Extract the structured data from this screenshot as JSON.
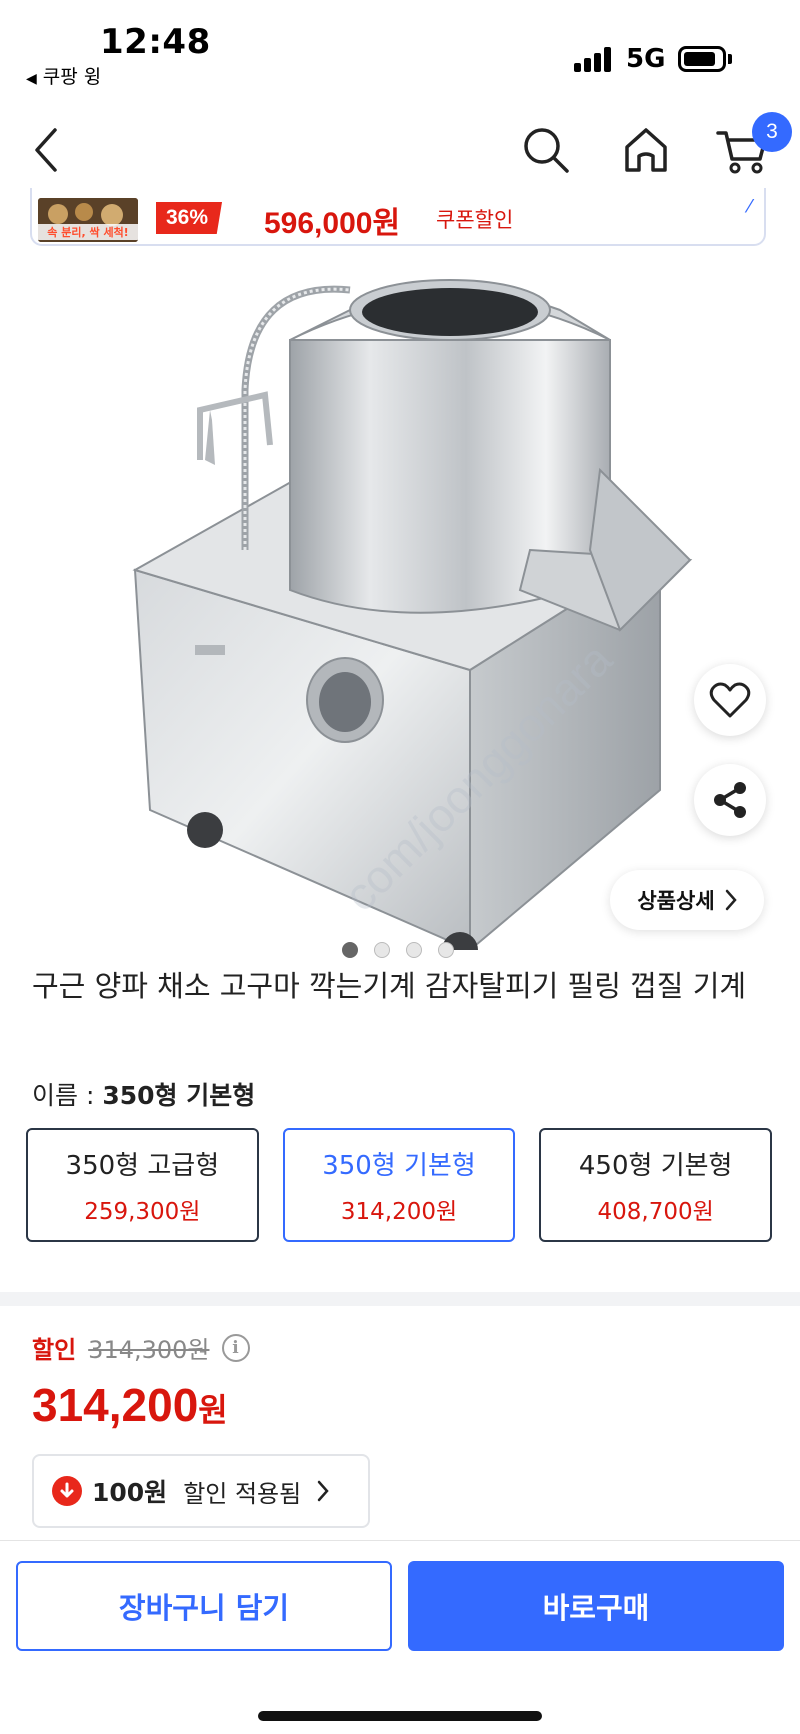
{
  "status_bar": {
    "time": "12:48",
    "back_app": "쿠팡 윙",
    "network": "5G",
    "battery_level": 0.85
  },
  "nav": {
    "back_icon": "chevron-left-icon",
    "search_icon": "search-icon",
    "home_icon": "home-icon",
    "cart_icon": "cart-icon",
    "cart_count": "3"
  },
  "coupon_banner": {
    "thumb_text": "속 분리, 싹 세척!",
    "discount_rate": "36%",
    "price": "596,000원",
    "label": "쿠폰할인"
  },
  "product": {
    "watermark": "com/joonggonara",
    "detail_button": "상품상세",
    "image_count": 4,
    "active_image": 1,
    "title": "구근 양파 채소 고구마 깍는기계 감자탈피기 필링 껍질 기계"
  },
  "options": {
    "name_label": "이름 : ",
    "selected_name": "350형 기본형",
    "items": [
      {
        "label": "350형 고급형",
        "price": "259,300원"
      },
      {
        "label": "350형 기본형",
        "price": "314,200원"
      },
      {
        "label": "450형 기본형",
        "price": "408,700원"
      }
    ]
  },
  "pricing": {
    "sale_label": "할인",
    "original_price": "314,300원",
    "final_amount": "314,200",
    "final_unit": "원",
    "discount_amount": "100원",
    "discount_label": "할인 적용됨"
  },
  "actions": {
    "add_to_cart": "장바구니 담기",
    "buy_now": "바로구매"
  },
  "colors": {
    "accent": "#346aff",
    "price_red": "#d8160d"
  }
}
